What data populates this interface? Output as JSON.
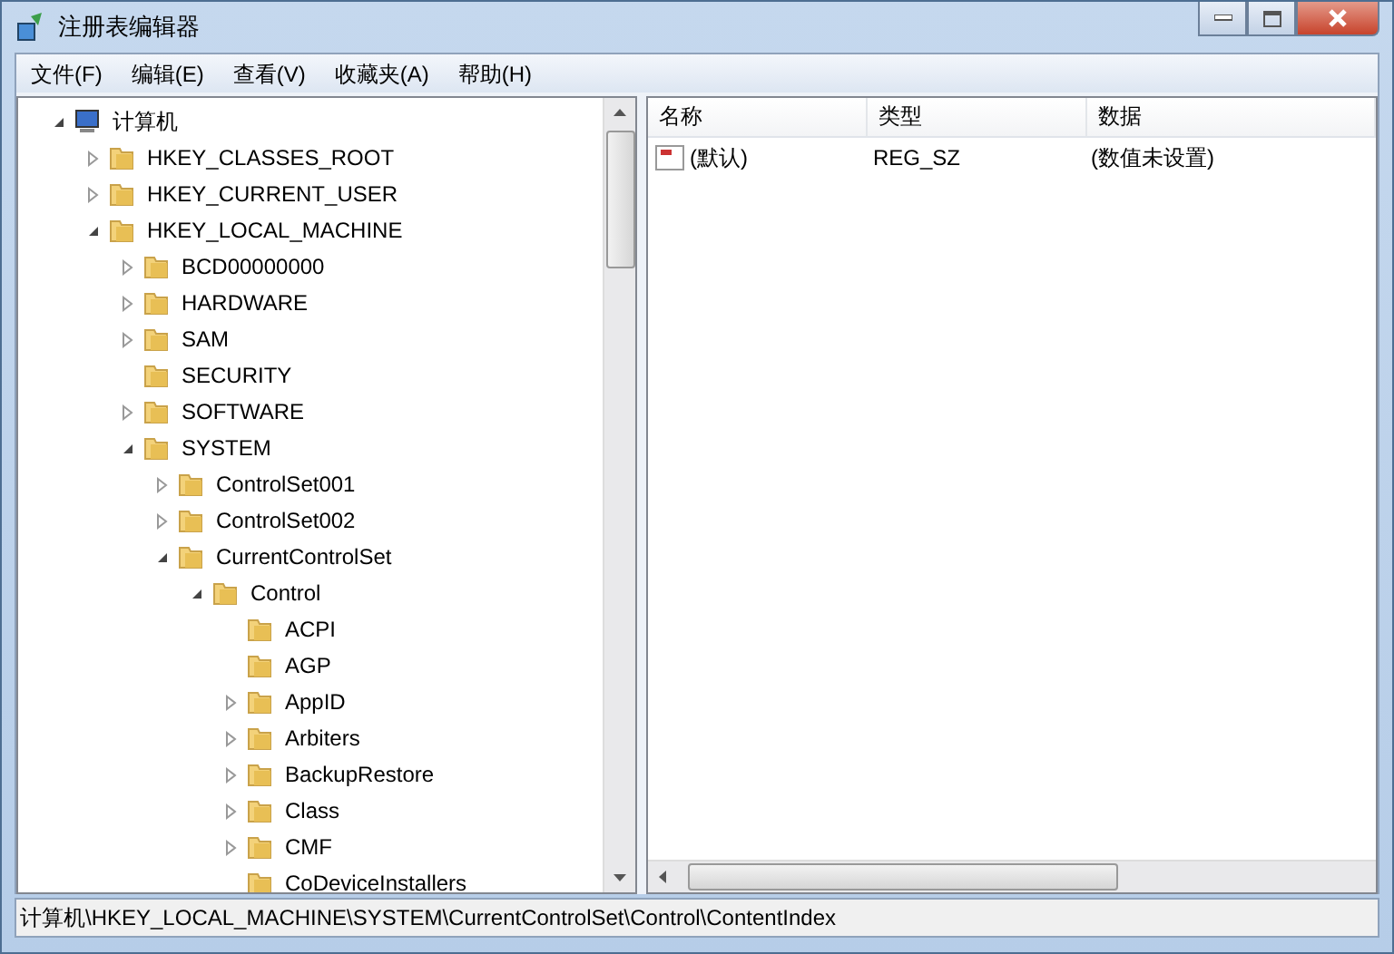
{
  "window": {
    "title": "注册表编辑器"
  },
  "menu": [
    "文件(F)",
    "编辑(E)",
    "查看(V)",
    "收藏夹(A)",
    "帮助(H)"
  ],
  "tree": [
    {
      "label": "计算机",
      "kind": "computer",
      "expanded": true,
      "children": [
        {
          "label": "HKEY_CLASSES_ROOT",
          "kind": "folder",
          "expanded": false
        },
        {
          "label": "HKEY_CURRENT_USER",
          "kind": "folder",
          "expanded": false
        },
        {
          "label": "HKEY_LOCAL_MACHINE",
          "kind": "folder",
          "expanded": true,
          "children": [
            {
              "label": "BCD00000000",
              "kind": "folder",
              "expanded": false
            },
            {
              "label": "HARDWARE",
              "kind": "folder",
              "expanded": false
            },
            {
              "label": "SAM",
              "kind": "folder",
              "expanded": false
            },
            {
              "label": "SECURITY",
              "kind": "folder"
            },
            {
              "label": "SOFTWARE",
              "kind": "folder",
              "expanded": false
            },
            {
              "label": "SYSTEM",
              "kind": "folder",
              "expanded": true,
              "children": [
                {
                  "label": "ControlSet001",
                  "kind": "folder",
                  "expanded": false
                },
                {
                  "label": "ControlSet002",
                  "kind": "folder",
                  "expanded": false
                },
                {
                  "label": "CurrentControlSet",
                  "kind": "folder",
                  "expanded": true,
                  "children": [
                    {
                      "label": "Control",
                      "kind": "folder",
                      "expanded": true,
                      "children": [
                        {
                          "label": "ACPI",
                          "kind": "folder"
                        },
                        {
                          "label": "AGP",
                          "kind": "folder"
                        },
                        {
                          "label": "AppID",
                          "kind": "folder",
                          "expanded": false
                        },
                        {
                          "label": "Arbiters",
                          "kind": "folder",
                          "expanded": false
                        },
                        {
                          "label": "BackupRestore",
                          "kind": "folder",
                          "expanded": false
                        },
                        {
                          "label": "Class",
                          "kind": "folder",
                          "expanded": false
                        },
                        {
                          "label": "CMF",
                          "kind": "folder",
                          "expanded": false
                        },
                        {
                          "label": "CoDeviceInstallers",
                          "kind": "folder"
                        }
                      ]
                    }
                  ]
                }
              ]
            }
          ]
        }
      ]
    }
  ],
  "values": {
    "columns": [
      "名称",
      "类型",
      "数据"
    ],
    "rows": [
      {
        "name": "(默认)",
        "type": "REG_SZ",
        "data": "(数值未设置)"
      }
    ]
  },
  "status_bar": "计算机\\HKEY_LOCAL_MACHINE\\SYSTEM\\CurrentControlSet\\Control\\ContentIndex"
}
